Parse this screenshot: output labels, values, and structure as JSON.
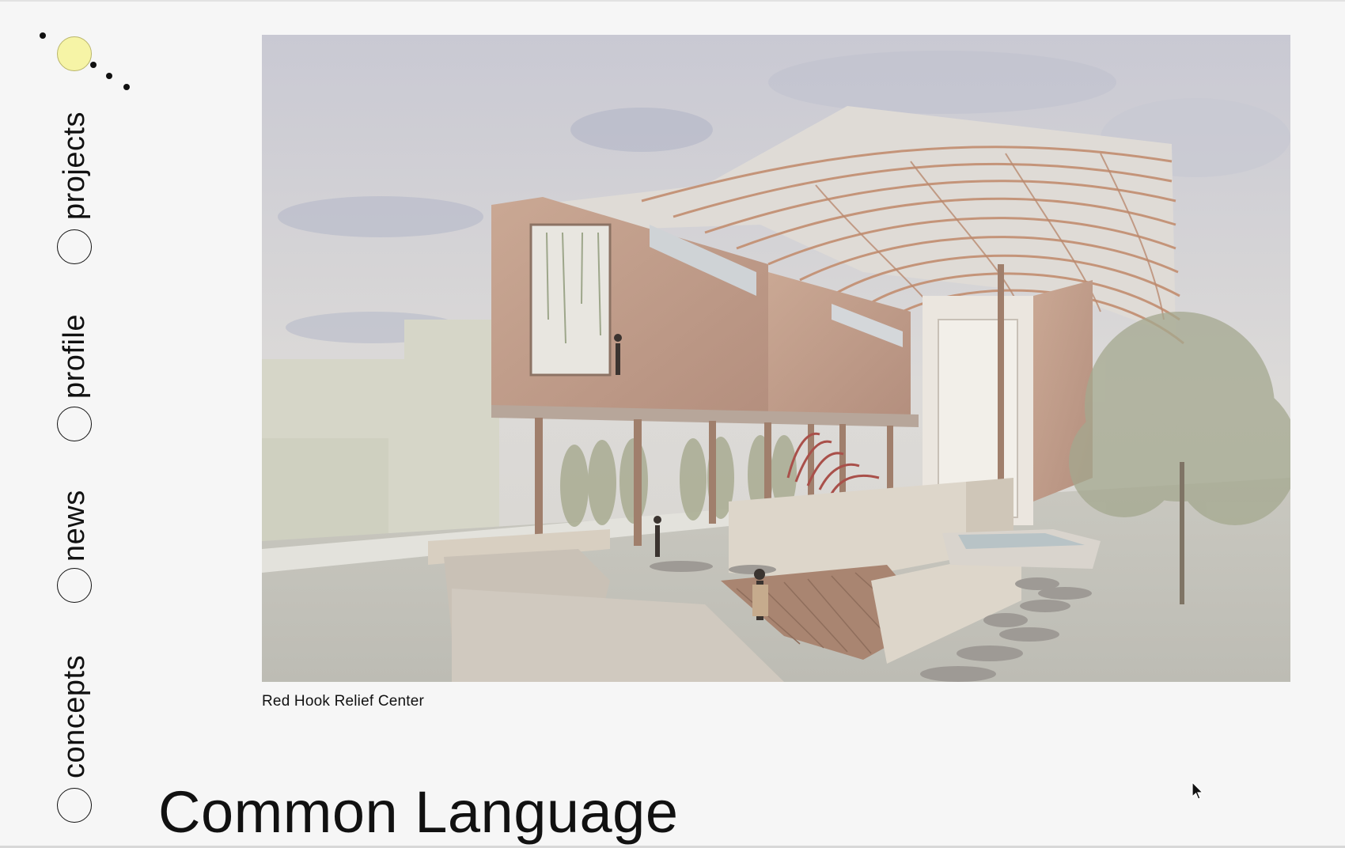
{
  "nav": {
    "items": [
      {
        "label": "projects"
      },
      {
        "label": "profile"
      },
      {
        "label": "news"
      },
      {
        "label": "concepts"
      }
    ]
  },
  "project": {
    "caption": "Red Hook Relief Center",
    "title": "Common Language"
  },
  "icons": {
    "logo": "sun-and-dots-logo",
    "nav_marker": "circle-outline-icon",
    "cursor": "mouse-pointer-icon"
  },
  "colors": {
    "background": "#f6f6f6",
    "logo_sun": "#f6f4a6",
    "text": "#111111"
  }
}
